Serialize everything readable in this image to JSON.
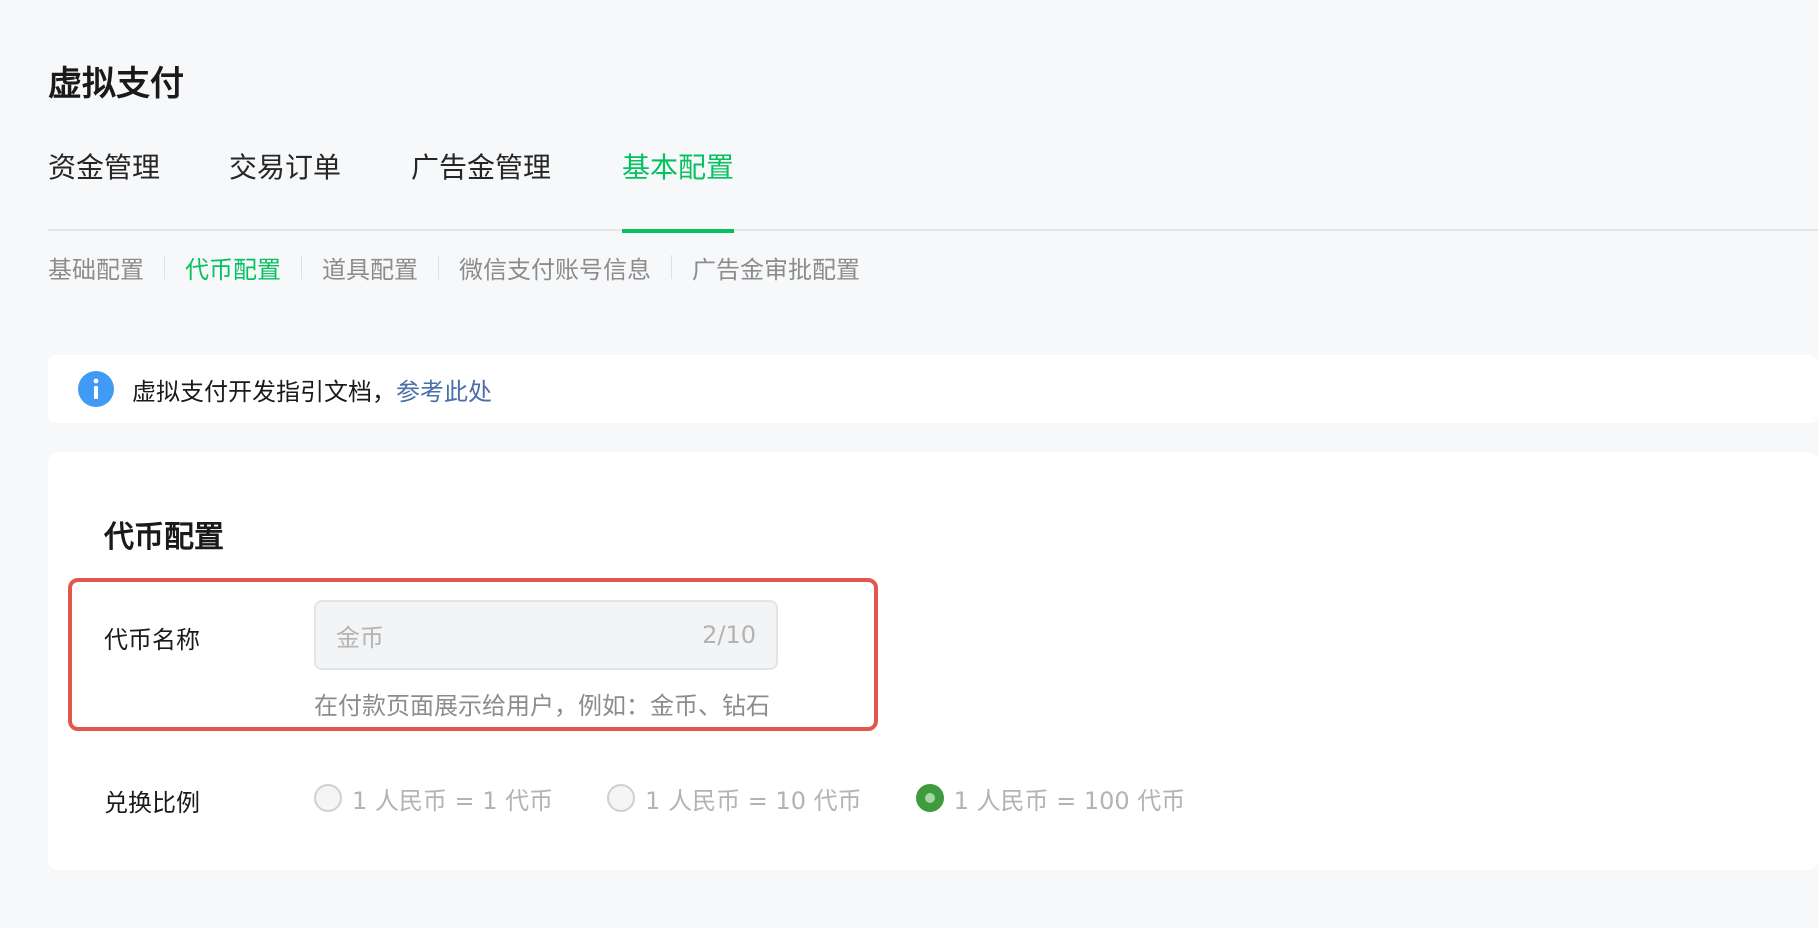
{
  "page": {
    "title": "虚拟支付"
  },
  "tabs": [
    {
      "label": "资金管理",
      "active": false
    },
    {
      "label": "交易订单",
      "active": false
    },
    {
      "label": "广告金管理",
      "active": false
    },
    {
      "label": "基本配置",
      "active": true
    }
  ],
  "subnav": [
    {
      "label": "基础配置",
      "active": false
    },
    {
      "label": "代币配置",
      "active": true
    },
    {
      "label": "道具配置",
      "active": false
    },
    {
      "label": "微信支付账号信息",
      "active": false
    },
    {
      "label": "广告金审批配置",
      "active": false
    }
  ],
  "notice": {
    "icon": "info-icon",
    "text": "虚拟支付开发指引文档，",
    "link": "参考此处"
  },
  "token_config": {
    "title": "代币配置",
    "name_label": "代币名称",
    "name_value": "金币",
    "name_counter": "2/10",
    "name_helper": "在付款页面展示给用户，例如：金币、钻石",
    "ratio_label": "兑换比例",
    "ratio_options": [
      {
        "label": "1 人民币 = 1 代币",
        "checked": false
      },
      {
        "label": "1 人民币 = 10 代币",
        "checked": false
      },
      {
        "label": "1 人民币 = 100 代币",
        "checked": true
      }
    ]
  },
  "colors": {
    "accent": "#07c160",
    "highlight_border": "#e0584c",
    "link": "#4a6ea8",
    "info_icon": "#3f9bf5"
  }
}
